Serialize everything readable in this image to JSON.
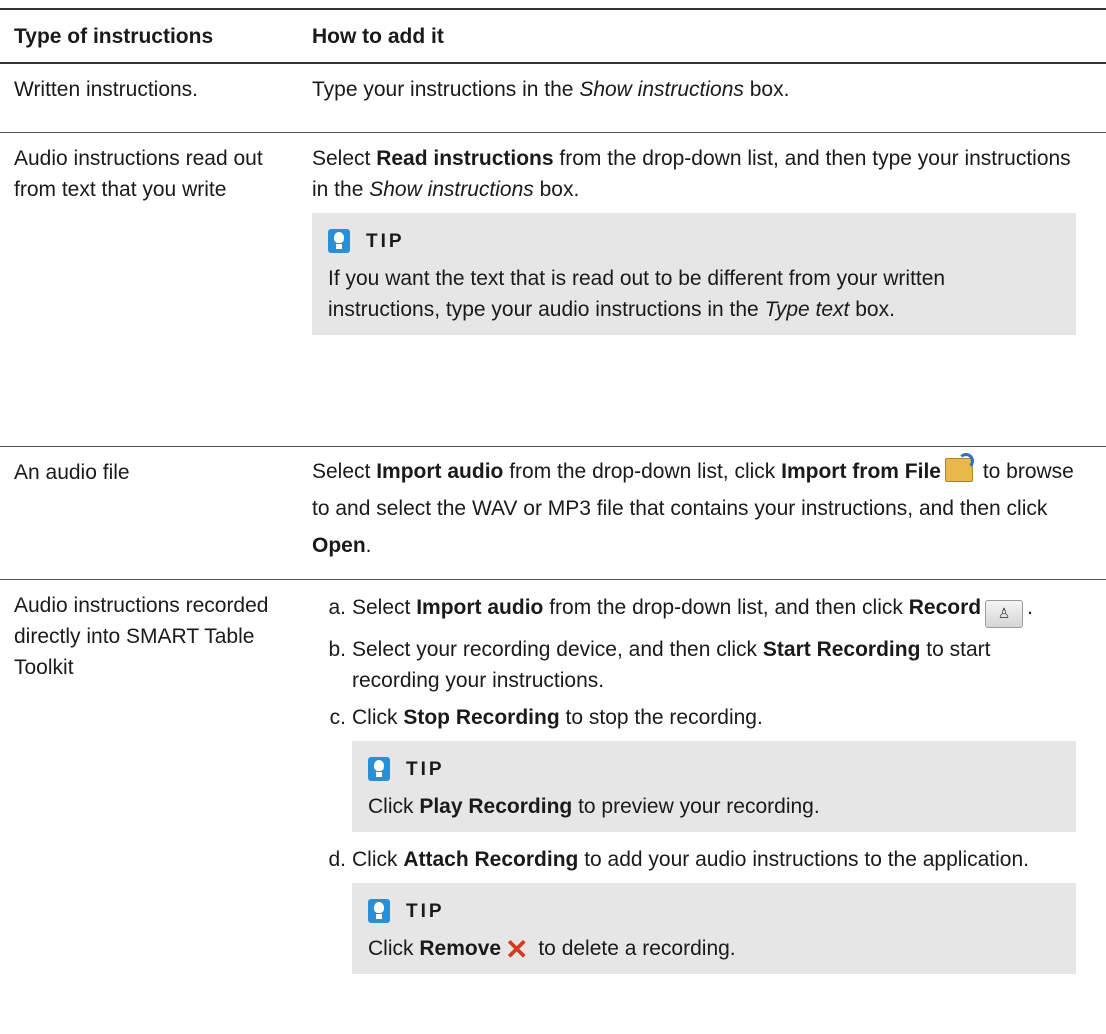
{
  "header": {
    "col1": "Type of instructions",
    "col2": "How to add it"
  },
  "rows": [
    {
      "type": "Written instructions.",
      "desc": {
        "a": "Type your instructions in the ",
        "b": "Show instructions",
        "c": " box."
      }
    },
    {
      "type": "Audio instructions read out from text that you write",
      "desc": {
        "a": "Select ",
        "b": "Read instructions",
        "c": " from the drop-down list, and then type your instructions in the ",
        "d": "Show instructions",
        "e": " box."
      },
      "tip": {
        "label": "TIP",
        "a": "If you want the text that is read out to be different from your written instructions, type your audio instructions in the ",
        "b": "Type text",
        "c": " box."
      }
    },
    {
      "type": "An audio file",
      "desc": {
        "a": "Select ",
        "b": "Import audio",
        "c": " from the drop-down list, click ",
        "d": "Import from File",
        "e": " to browse to and select the WAV or MP3 file that contains your instructions, and then click ",
        "f": "Open",
        "g": "."
      }
    },
    {
      "type": "Audio instructions recorded directly into SMART Table Toolkit",
      "steps": [
        {
          "marker": "a.",
          "a": "Select ",
          "b": "Import audio",
          "c": " from the drop-down list, and then click ",
          "d": "Record",
          "e": "."
        },
        {
          "marker": "b.",
          "a": "Select your recording device, and then click ",
          "b": "Start Recording",
          "c": " to start recording your instructions."
        },
        {
          "marker": "c.",
          "a": "Click ",
          "b": "Stop Recording",
          "c": " to stop the recording."
        },
        {
          "marker": "d.",
          "a": "Click ",
          "b": "Attach Recording",
          "c": " to add your audio instructions to the application."
        }
      ],
      "tip1": {
        "label": "TIP",
        "a": "Click ",
        "b": "Play Recording",
        "c": " to preview your recording."
      },
      "tip2": {
        "label": "TIP",
        "a": "Click ",
        "b": "Remove",
        "c": " to delete a recording."
      }
    }
  ],
  "icons": {
    "tip": "lightbulb-icon",
    "import_from_file": "folder-open-icon",
    "record": "microphone-icon",
    "remove": "red-x-icon"
  },
  "colors": {
    "tip_bg": "#e6e6e6",
    "tip_icon": "#2b8fd6",
    "remove": "#d53a1e"
  }
}
